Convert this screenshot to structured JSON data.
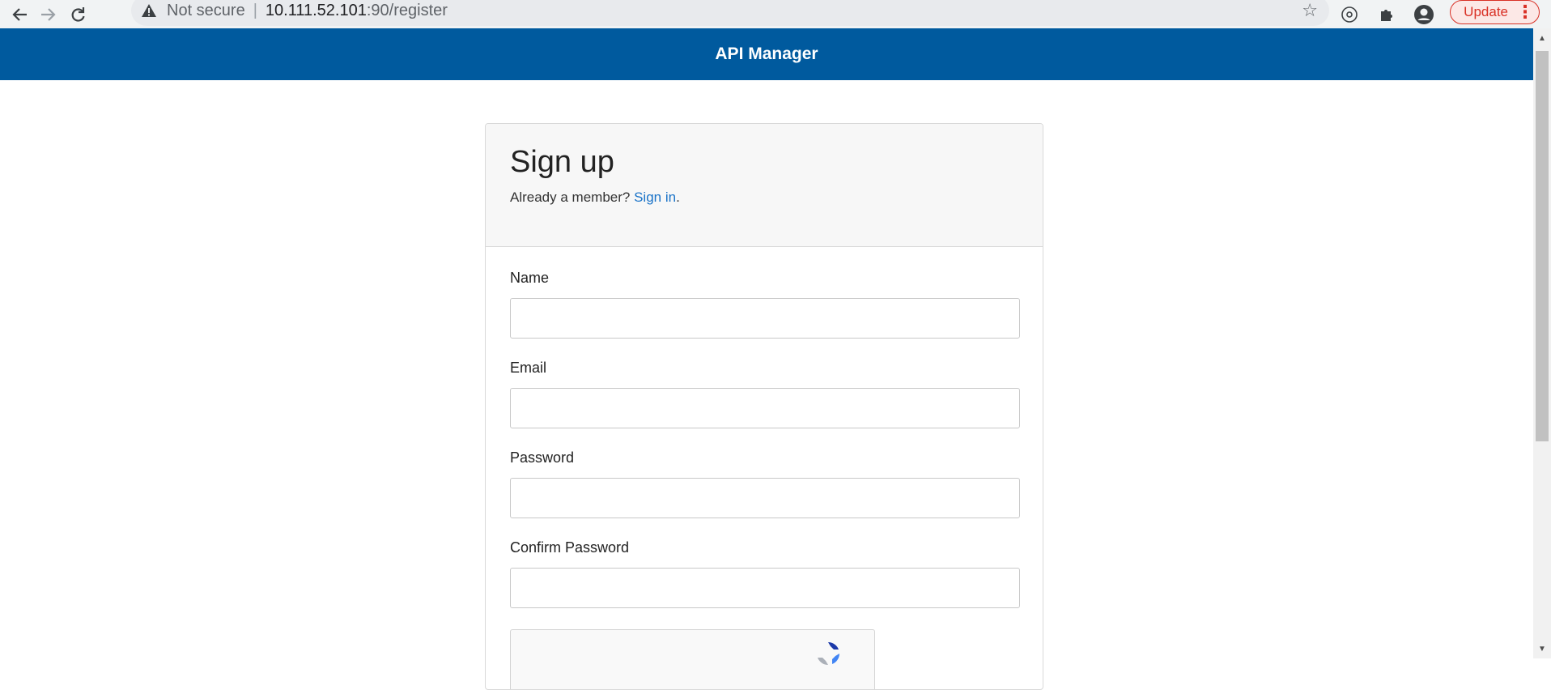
{
  "browser": {
    "security_label": "Not secure",
    "url_host": "10.111.52.101",
    "url_rest": ":90/register",
    "update_label": "Update"
  },
  "header": {
    "title": "API Manager",
    "background_color": "#005a9e"
  },
  "card": {
    "title": "Sign up",
    "subtitle_prefix": "Already a member? ",
    "signin_link": "Sign in",
    "subtitle_suffix": "."
  },
  "form": {
    "fields": [
      {
        "label": "Name",
        "value": ""
      },
      {
        "label": "Email",
        "value": ""
      },
      {
        "label": "Password",
        "value": ""
      },
      {
        "label": "Confirm Password",
        "value": ""
      }
    ]
  },
  "icons": {
    "back": "arrow-left-icon",
    "forward": "arrow-right-icon",
    "reload": "reload-icon",
    "warning": "warning-icon",
    "bookmark": "star-icon",
    "media": "media-router-icon",
    "extensions": "puzzle-icon",
    "profile": "account-icon",
    "menu": "more-vert-icon",
    "captcha": "recaptcha-icon"
  }
}
